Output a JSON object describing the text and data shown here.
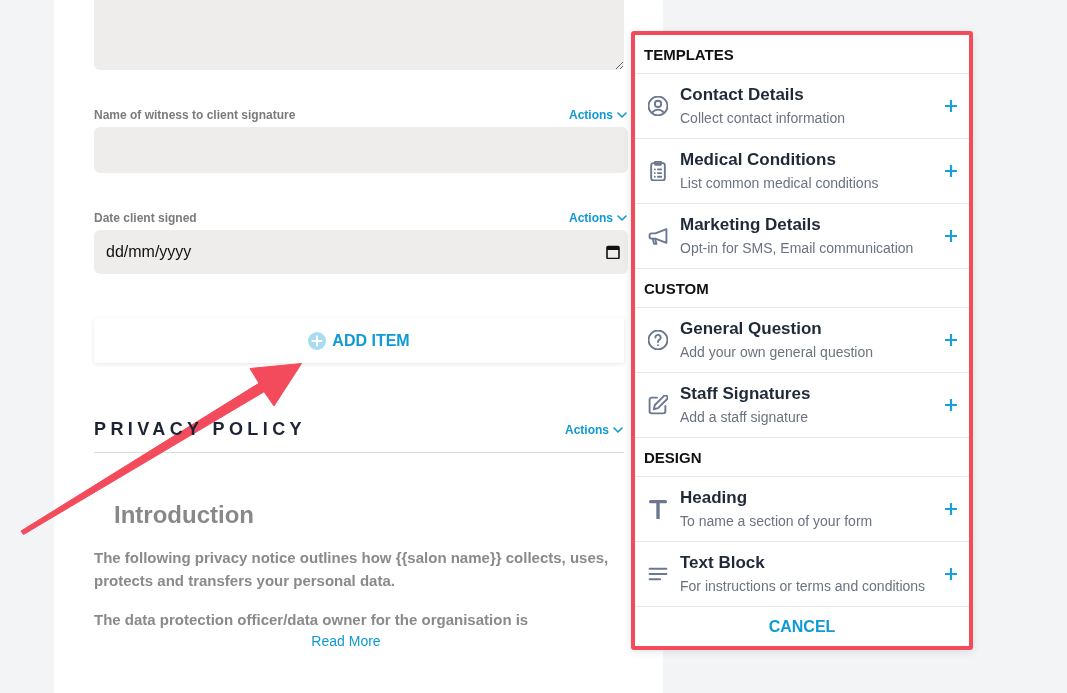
{
  "form": {
    "fields": [
      {
        "kind": "textarea"
      },
      {
        "kind": "text",
        "label": "Name of witness to client signature",
        "actions": "Actions"
      },
      {
        "kind": "date",
        "label": "Date client signed",
        "actions": "Actions",
        "placeholder": "dd/mm/yyyy"
      }
    ],
    "add_item_button": "ADD ITEM",
    "section": {
      "title": "PRIVACY POLICY",
      "actions": "Actions",
      "heading": "Introduction",
      "paragraphs": [
        "The following privacy notice outlines how {{salon name}} collects, uses, protects and transfers your personal data.",
        "The data protection officer/data owner for the organisation is"
      ],
      "read_more": "Read More"
    }
  },
  "add_menu": {
    "sections": [
      {
        "title": "TEMPLATES",
        "items": [
          {
            "kind": "contact",
            "title": "Contact Details",
            "description": "Collect contact information"
          },
          {
            "kind": "medical",
            "title": "Medical Conditions",
            "description": "List common medical conditions"
          },
          {
            "kind": "marketing",
            "title": "Marketing Details",
            "description": "Opt-in for SMS, Email communication"
          }
        ]
      },
      {
        "title": "CUSTOM",
        "items": [
          {
            "kind": "question",
            "title": "General Question",
            "description": "Add your own general question"
          },
          {
            "kind": "signature",
            "title": "Staff Signatures",
            "description": "Add a staff signature"
          }
        ]
      },
      {
        "title": "DESIGN",
        "items": [
          {
            "kind": "heading",
            "title": "Heading",
            "description": "To name a section of your form"
          },
          {
            "kind": "text",
            "title": "Text Block",
            "description": "For instructions or terms and conditions"
          }
        ]
      }
    ],
    "cancel": "CANCEL"
  }
}
